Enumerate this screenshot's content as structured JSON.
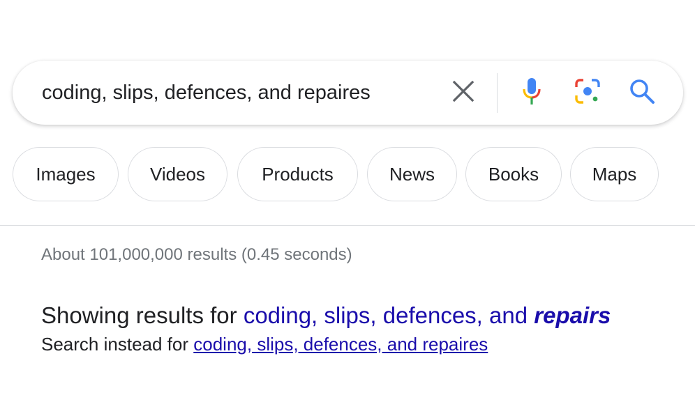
{
  "search": {
    "query": "coding, slips, defences, and repaires"
  },
  "icons": {
    "clear": "close-icon",
    "voice": "microphone-icon",
    "lens": "camera-lens-icon",
    "search": "magnifier-icon"
  },
  "colors": {
    "link": "#1a0dab",
    "muted": "#70757a",
    "google_blue": "#4285f4",
    "google_red": "#ea4335",
    "google_yellow": "#fbbc04",
    "google_green": "#34a853"
  },
  "chips": [
    {
      "label": "Images"
    },
    {
      "label": "Videos"
    },
    {
      "label": "Products"
    },
    {
      "label": "News"
    },
    {
      "label": "Books"
    },
    {
      "label": "Maps"
    }
  ],
  "results": {
    "stats": "About 101,000,000 results (0.45 seconds)",
    "showing_prefix": "Showing results for",
    "corrected_plain": "coding, slips, defences, and",
    "corrected_emphasis": "repairs",
    "instead_prefix": "Search instead for",
    "original_query": "coding, slips, defences, and repaires"
  }
}
